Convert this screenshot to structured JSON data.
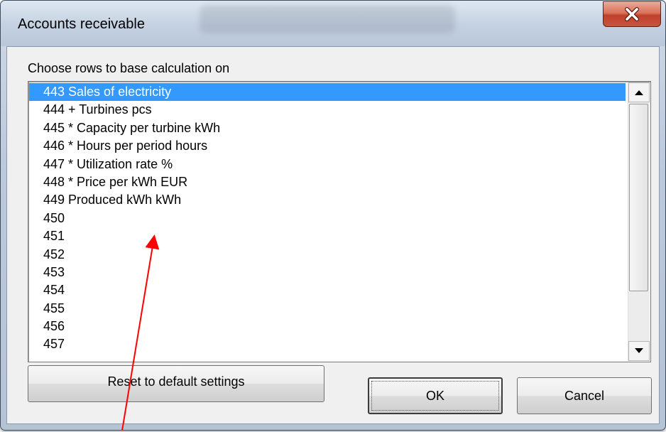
{
  "window": {
    "title": "Accounts receivable",
    "close_icon": "close-x-icon"
  },
  "dialog": {
    "prompt": "Choose rows to base calculation on",
    "rows": [
      {
        "label": "443 Sales of electricity",
        "selected": true
      },
      {
        "label": "444 + Turbines pcs",
        "selected": false
      },
      {
        "label": "445 * Capacity per turbine kWh",
        "selected": false
      },
      {
        "label": "446 * Hours per period hours",
        "selected": false
      },
      {
        "label": "447 * Utilization rate %",
        "selected": false
      },
      {
        "label": "448 * Price per kWh EUR",
        "selected": false
      },
      {
        "label": "449 Produced kWh kWh",
        "selected": false
      },
      {
        "label": "450",
        "selected": false
      },
      {
        "label": "451",
        "selected": false
      },
      {
        "label": "452",
        "selected": false
      },
      {
        "label": "453",
        "selected": false
      },
      {
        "label": "454",
        "selected": false
      },
      {
        "label": "455",
        "selected": false
      },
      {
        "label": "456",
        "selected": false
      },
      {
        "label": "457",
        "selected": false
      }
    ],
    "reset_label": "Reset to default settings",
    "ok_label": "OK",
    "cancel_label": "Cancel"
  },
  "colors": {
    "selection": "#3399ff",
    "annotation_arrow": "#ff0000"
  }
}
